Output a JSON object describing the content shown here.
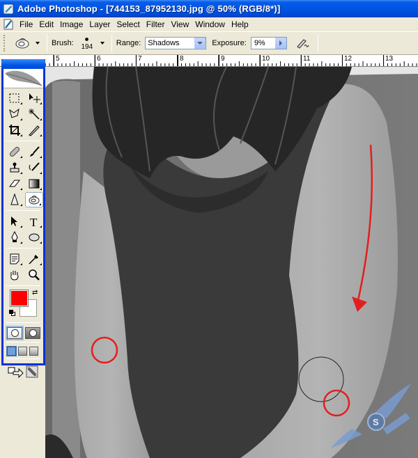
{
  "window": {
    "title": "Adobe Photoshop - [744153_87952130.jpg @ 50% (RGB/8*)]",
    "app_icon": "photoshop-icon"
  },
  "menu": {
    "items": [
      "File",
      "Edit",
      "Image",
      "Layer",
      "Select",
      "Filter",
      "View",
      "Window",
      "Help"
    ]
  },
  "options_bar": {
    "tool_preset_icon": "dodge-tool-icon",
    "brush_label": "Brush:",
    "brush_size": "194",
    "range_label": "Range:",
    "range_value": "Shadows",
    "exposure_label": "Exposure:",
    "exposure_value": "9%",
    "airbrush_icon": "airbrush-icon"
  },
  "ruler": {
    "labels": [
      "5",
      "6",
      "7",
      "8",
      "9",
      "10",
      "11",
      "12",
      "13"
    ]
  },
  "toolbox": {
    "tools": [
      {
        "name": "rectangular-marquee-tool-icon",
        "active": false
      },
      {
        "name": "move-tool-icon",
        "active": false
      },
      {
        "name": "lasso-tool-icon",
        "active": false
      },
      {
        "name": "magic-wand-tool-icon",
        "active": false
      },
      {
        "name": "crop-tool-icon",
        "active": false
      },
      {
        "name": "slice-tool-icon",
        "active": false
      },
      {
        "name": "healing-brush-tool-icon",
        "active": false
      },
      {
        "name": "brush-tool-icon",
        "active": false
      },
      {
        "name": "clone-stamp-tool-icon",
        "active": false
      },
      {
        "name": "history-brush-tool-icon",
        "active": false
      },
      {
        "name": "eraser-tool-icon",
        "active": false
      },
      {
        "name": "gradient-tool-icon",
        "active": false
      },
      {
        "name": "blur-tool-icon",
        "active": false
      },
      {
        "name": "dodge-tool-icon",
        "active": true
      },
      {
        "name": "path-selection-tool-icon",
        "active": false
      },
      {
        "name": "type-tool-icon",
        "active": false
      },
      {
        "name": "pen-tool-icon",
        "active": false
      },
      {
        "name": "ellipse-tool-icon",
        "active": false
      },
      {
        "name": "notes-tool-icon",
        "active": false
      },
      {
        "name": "eyedropper-tool-icon",
        "active": false
      },
      {
        "name": "hand-tool-icon",
        "active": false
      },
      {
        "name": "zoom-tool-icon",
        "active": false
      }
    ],
    "foreground_color": "#ff0000",
    "background_color": "#ffffff"
  },
  "canvas": {
    "zoom": "50%",
    "annotation_color": "#e41e1e"
  }
}
